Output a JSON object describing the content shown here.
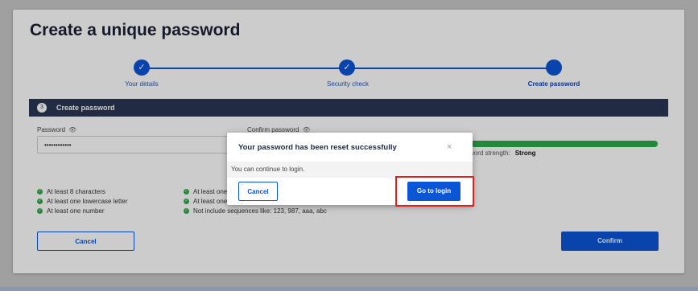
{
  "page": {
    "title": "Create a unique password"
  },
  "stepper": {
    "steps": [
      {
        "label": "Your details",
        "state": "done",
        "icon": "check-icon"
      },
      {
        "label": "Security check",
        "state": "done",
        "icon": "check-icon"
      },
      {
        "label": "Create password",
        "state": "active",
        "icon": ""
      }
    ]
  },
  "section": {
    "number": "3",
    "title": "Create password"
  },
  "form": {
    "password_label": "Password",
    "password_value": "••••••••••••",
    "confirm_label": "Confirm password",
    "strength_label_partial": "word strength:",
    "strength_value": "Strong"
  },
  "requirements": {
    "col1": [
      "At least 8 characters",
      "At least one lowercase letter",
      "At least one number"
    ],
    "col2": [
      "At least one",
      "At least one",
      "Not include sequences like: 123, 987, aaa, abc"
    ]
  },
  "actions": {
    "cancel_label": "Cancel",
    "confirm_label": "Confirm"
  },
  "modal": {
    "title": "Your password has been reset successfully",
    "close_glyph": "×",
    "body": "You can continue to login.",
    "cancel_label": "Cancel",
    "login_label": "Go to login"
  },
  "colors": {
    "primary": "#0b56d6",
    "header_bar": "#2b3655",
    "success": "#2eab4a",
    "highlight": "#e02020"
  }
}
